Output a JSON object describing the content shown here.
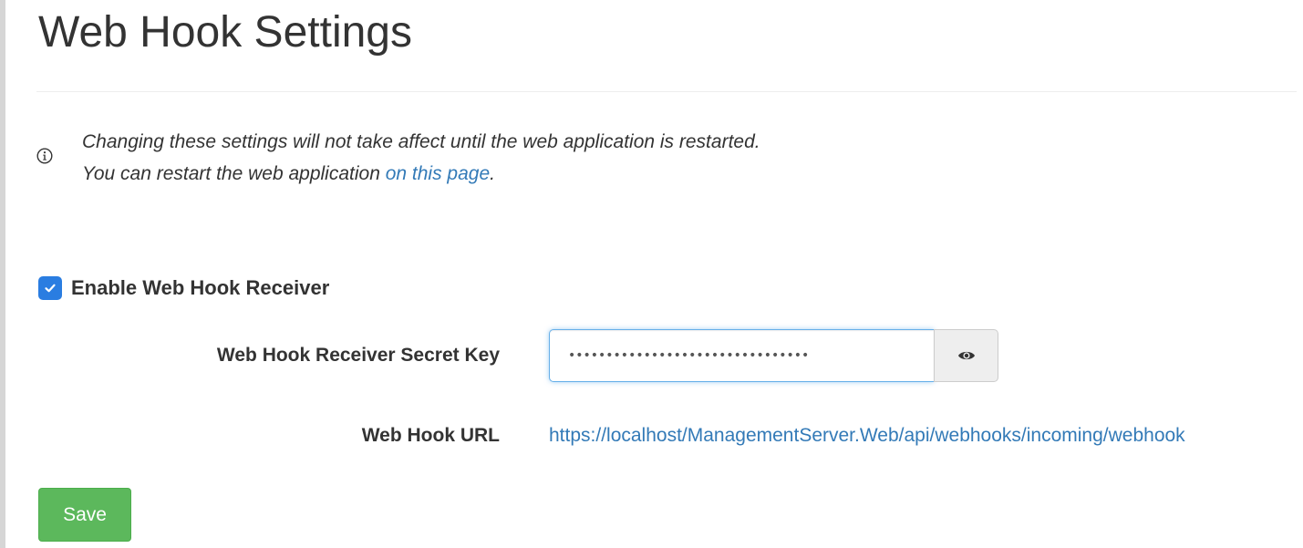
{
  "header": {
    "title": "Web Hook Settings"
  },
  "notice": {
    "icon": "info-icon",
    "line1": "Changing these settings will not take affect until the web application is restarted.",
    "line2_prefix": "You can restart the web application ",
    "line2_link": "on this page",
    "line2_suffix": "."
  },
  "form": {
    "enable_receiver": {
      "label": "Enable Web Hook Receiver",
      "checked": true
    },
    "secret_key": {
      "label": "Web Hook Receiver Secret Key",
      "masked_value": "••••••••••••••••••••••••••••••••",
      "reveal_icon": "eye-icon"
    },
    "url": {
      "label": "Web Hook URL",
      "value": "https://localhost/ManagementServer.Web/api/webhooks/incoming/webhook"
    },
    "save_label": "Save"
  },
  "colors": {
    "link": "#337ab7",
    "checkbox": "#2a7de1",
    "save_button": "#5cb85c",
    "focus_border": "#66afe9"
  }
}
